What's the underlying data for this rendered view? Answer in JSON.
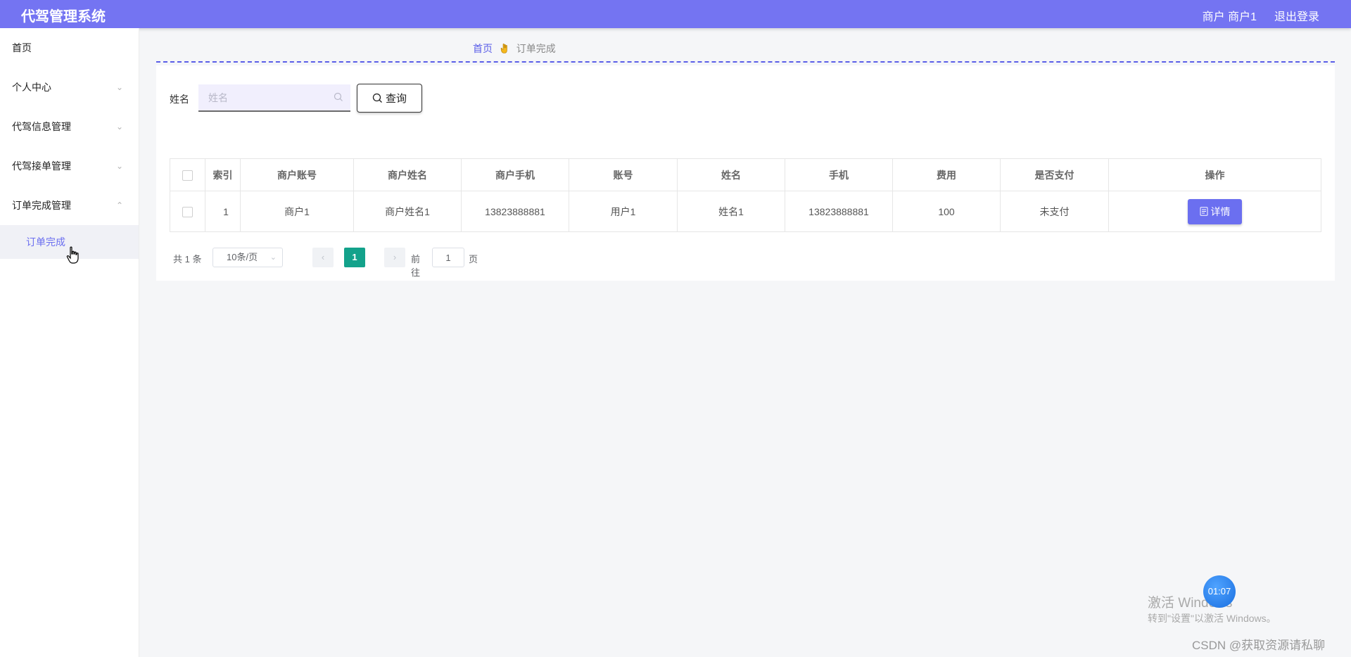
{
  "app": {
    "title": "代驾管理系统"
  },
  "header": {
    "user": "商户 商户1",
    "logout": "退出登录"
  },
  "sidebar": {
    "items": [
      {
        "label": "首页"
      },
      {
        "label": "个人中心"
      },
      {
        "label": "代驾信息管理"
      },
      {
        "label": "代驾接单管理"
      },
      {
        "label": "订单完成管理"
      }
    ],
    "sub_item": "订单完成"
  },
  "breadcrumb": {
    "home": "首页",
    "current": "订单完成"
  },
  "search": {
    "label": "姓名",
    "placeholder": "姓名",
    "button": "查询"
  },
  "table": {
    "headers": [
      "索引",
      "商户账号",
      "商户姓名",
      "商户手机",
      "账号",
      "姓名",
      "手机",
      "费用",
      "是否支付",
      "操作"
    ],
    "rows": [
      {
        "index": "1",
        "merchant_account": "商户1",
        "merchant_name": "商户姓名1",
        "merchant_phone": "13823888881",
        "account": "用户1",
        "name": "姓名1",
        "phone": "13823888881",
        "fee": "100",
        "paid": "未支付",
        "action": "详情"
      }
    ]
  },
  "pagination": {
    "total": "共 1 条",
    "page_size": "10条/页",
    "current_page": "1",
    "goto_label": "前往",
    "goto_value": "1",
    "page_suffix": "页"
  },
  "overlay": {
    "activate_title": "激活 Windows",
    "activate_hint": "转到\"设置\"以激活 Windows。",
    "timer": "01:07",
    "csdn": "CSDN @获取资源请私聊"
  },
  "colors": {
    "accent": "#7474f2",
    "button": "#6b6ff0",
    "page_active": "#13a28b"
  }
}
